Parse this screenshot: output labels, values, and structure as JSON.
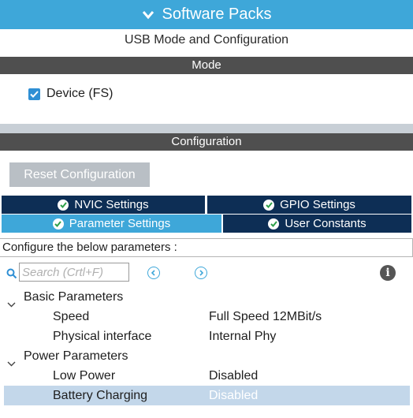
{
  "header": {
    "title": "Software Packs",
    "chevron_icon": "chevron-down-icon"
  },
  "subtitle": "USB Mode and Configuration",
  "mode": {
    "section_title": "Mode",
    "device_checkbox": {
      "label": "Device (FS)",
      "checked": true
    }
  },
  "configuration": {
    "section_title": "Configuration",
    "reset_button": "Reset Configuration",
    "tabs": [
      {
        "label": "NVIC Settings",
        "active": false
      },
      {
        "label": "GPIO Settings",
        "active": false
      },
      {
        "label": "Parameter Settings",
        "active": true
      },
      {
        "label": "User Constants",
        "active": false
      }
    ],
    "instructions": "Configure the below parameters :",
    "search": {
      "placeholder": "Search (Crtl+F)"
    },
    "groups": [
      {
        "label": "Basic Parameters",
        "params": [
          {
            "name": "Speed",
            "value": "Full Speed 12MBit/s"
          },
          {
            "name": "Physical interface",
            "value": "Internal Phy"
          }
        ]
      },
      {
        "label": "Power Parameters",
        "params": [
          {
            "name": "Low Power",
            "value": "Disabled"
          },
          {
            "name": "Battery Charging",
            "value": "Disabled",
            "selected": true
          }
        ]
      }
    ]
  },
  "colors": {
    "accent": "#3ea7d9",
    "tab_dark": "#0d2e55",
    "section_bar": "#4f4f4f",
    "selected_row": "#c3d7ea"
  }
}
